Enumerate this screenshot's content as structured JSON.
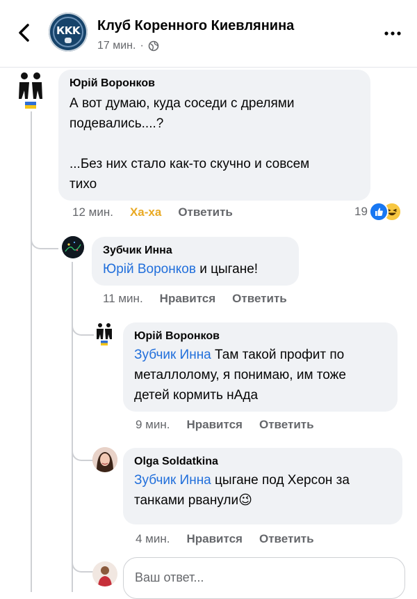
{
  "header": {
    "group_name": "Клуб Коренного Киевлянина",
    "logo_text": "КKK",
    "time": "17 мин.",
    "separator": "·",
    "privacy_icon": "globe-icon"
  },
  "comments": [
    {
      "author": "Юрій Воронков",
      "text_line1": "А вот думаю, куда соседи с дрелями",
      "text_line2": "подевались....?",
      "text_line3": "...Без них стало как-то скучно и совсем",
      "text_line4": "тихо",
      "time": "12 мин.",
      "reaction_label": "Ха-ха",
      "reply_label": "Ответить",
      "reaction_count": "19",
      "reaction_icons": [
        "like-icon",
        "haha-icon"
      ]
    },
    {
      "author": "Зубчик Инна",
      "mention": "Юрій Воронков",
      "text": " и цыгане!",
      "time": "11 мин.",
      "like_label": "Нравится",
      "reply_label": "Ответить"
    },
    {
      "author": "Юрій Воронков",
      "mention": "Зубчик Инна",
      "text_line1": " Там такой профит по",
      "text_line2": "металлолому, я понимаю, им тоже",
      "text_line3": "детей кормить нАда",
      "time": "9 мин.",
      "like_label": "Нравится",
      "reply_label": "Ответить"
    },
    {
      "author": "Olga Soldatkina",
      "mention": "Зубчик Инна",
      "text_line1": " цыгане под Херсон за",
      "text_line2": "танками рванули",
      "emoji": "😉",
      "time": "4 мин.",
      "like_label": "Нравится",
      "reply_label": "Ответить"
    }
  ],
  "reply_input": {
    "placeholder": "Ваш ответ..."
  },
  "colors": {
    "mention": "#216fdb",
    "haha": "#e9a923",
    "bubble": "#f0f2f5",
    "meta": "#65676b"
  }
}
